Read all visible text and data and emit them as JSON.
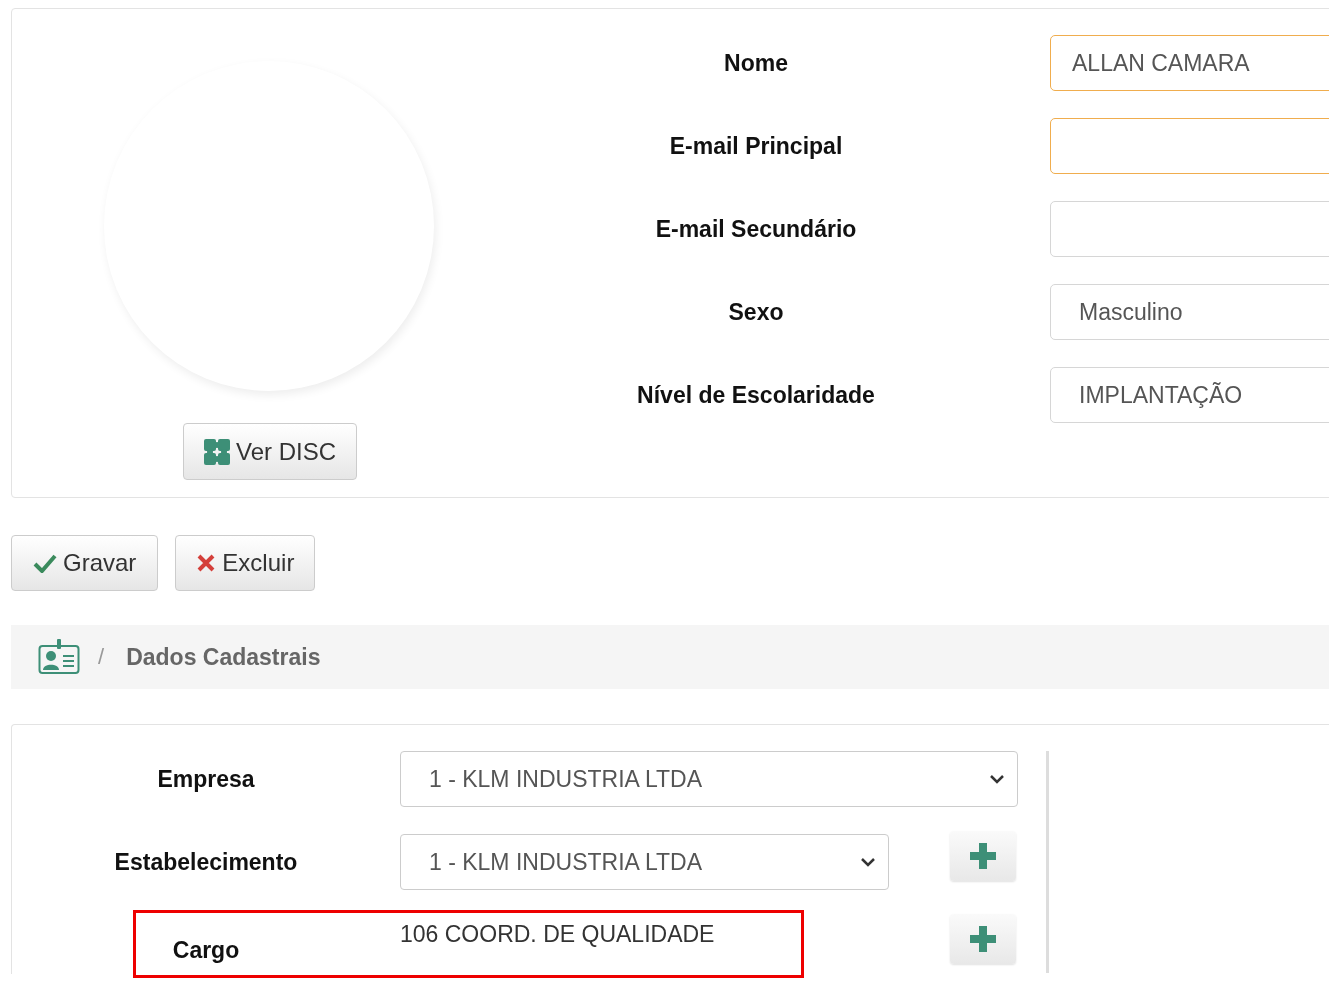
{
  "profile": {
    "disc_button": "Ver DISC"
  },
  "fields": [
    {
      "label": "Nome",
      "value": "ALLAN CAMARA",
      "highlighted": true
    },
    {
      "label": "E-mail Principal",
      "highlighted": true
    },
    {
      "label": "E-mail Secundário",
      "highlighted": false
    },
    {
      "label": "Sexo",
      "value": "Masculino",
      "highlighted": false
    },
    {
      "label": "Nível de Escolaridade",
      "value": "IMPLANTAÇÃO",
      "highlighted": false
    }
  ],
  "actions": [
    {
      "kind": "save",
      "label": "Gravar"
    },
    {
      "kind": "delete",
      "label": "Excluir"
    }
  ],
  "breadcrumb": {
    "separator": "/",
    "title": "Dados Cadastrais"
  },
  "company_fields": [
    {
      "kind": "select",
      "label": "Empresa",
      "value": "1 - KLM INDUSTRIA LTDA",
      "add_button": false,
      "annotated": false
    },
    {
      "kind": "select",
      "label": "Estabelecimento",
      "value": "1 - KLM INDUSTRIA LTDA",
      "add_button": true,
      "annotated": false
    },
    {
      "kind": "text",
      "label": "Cargo",
      "value": "106 COORD. DE QUALIDADE",
      "add_button": true,
      "annotated": true
    }
  ]
}
